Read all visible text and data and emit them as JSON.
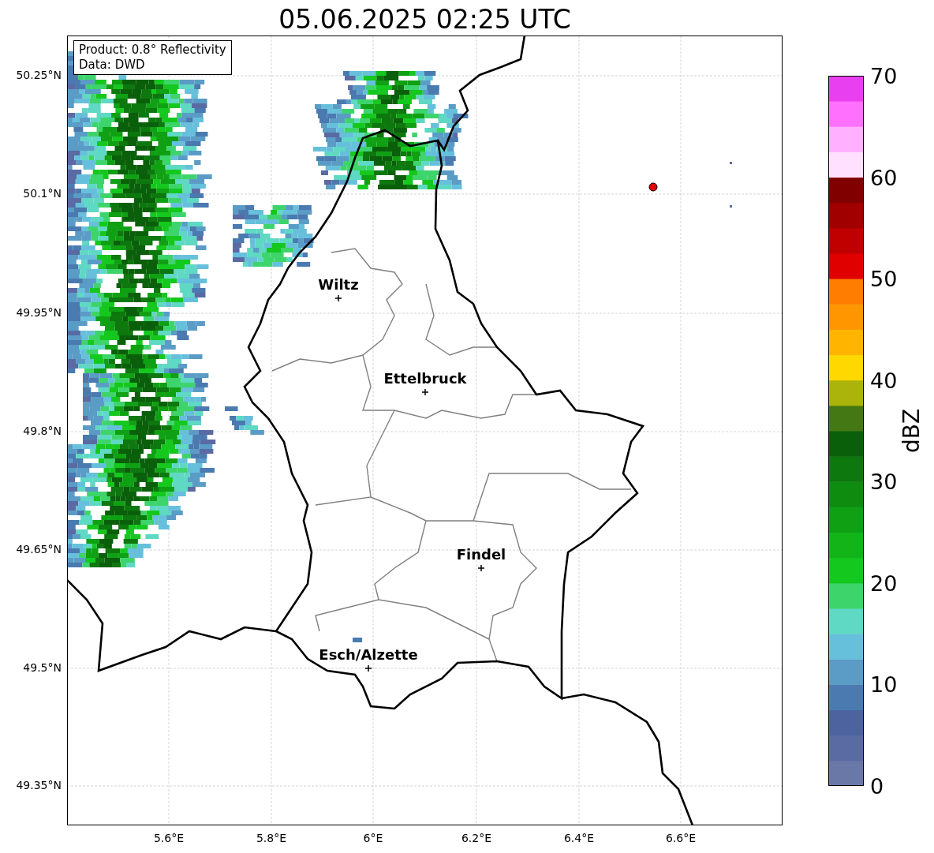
{
  "title": "05.06.2025 02:25 UTC",
  "info_box": {
    "lines": [
      "Product: 0.8° Reflectivity",
      "Data: DWD"
    ]
  },
  "map": {
    "lat_ticks": [
      "50.25°N",
      "50.1°N",
      "49.95°N",
      "49.8°N",
      "49.65°N",
      "49.5°N",
      "49.35°N"
    ],
    "lon_ticks": [
      "5.6°E",
      "5.8°E",
      "6°E",
      "6.2°E",
      "6.4°E",
      "6.6°E"
    ],
    "cities": [
      {
        "name": "Wiltz"
      },
      {
        "name": "Ettelbruck"
      },
      {
        "name": "Findel"
      },
      {
        "name": "Esch/Alzette"
      }
    ]
  },
  "colorbar": {
    "label": "dBZ",
    "ticks": [
      "70",
      "60",
      "50",
      "40",
      "30",
      "20",
      "10",
      "0"
    ]
  }
}
